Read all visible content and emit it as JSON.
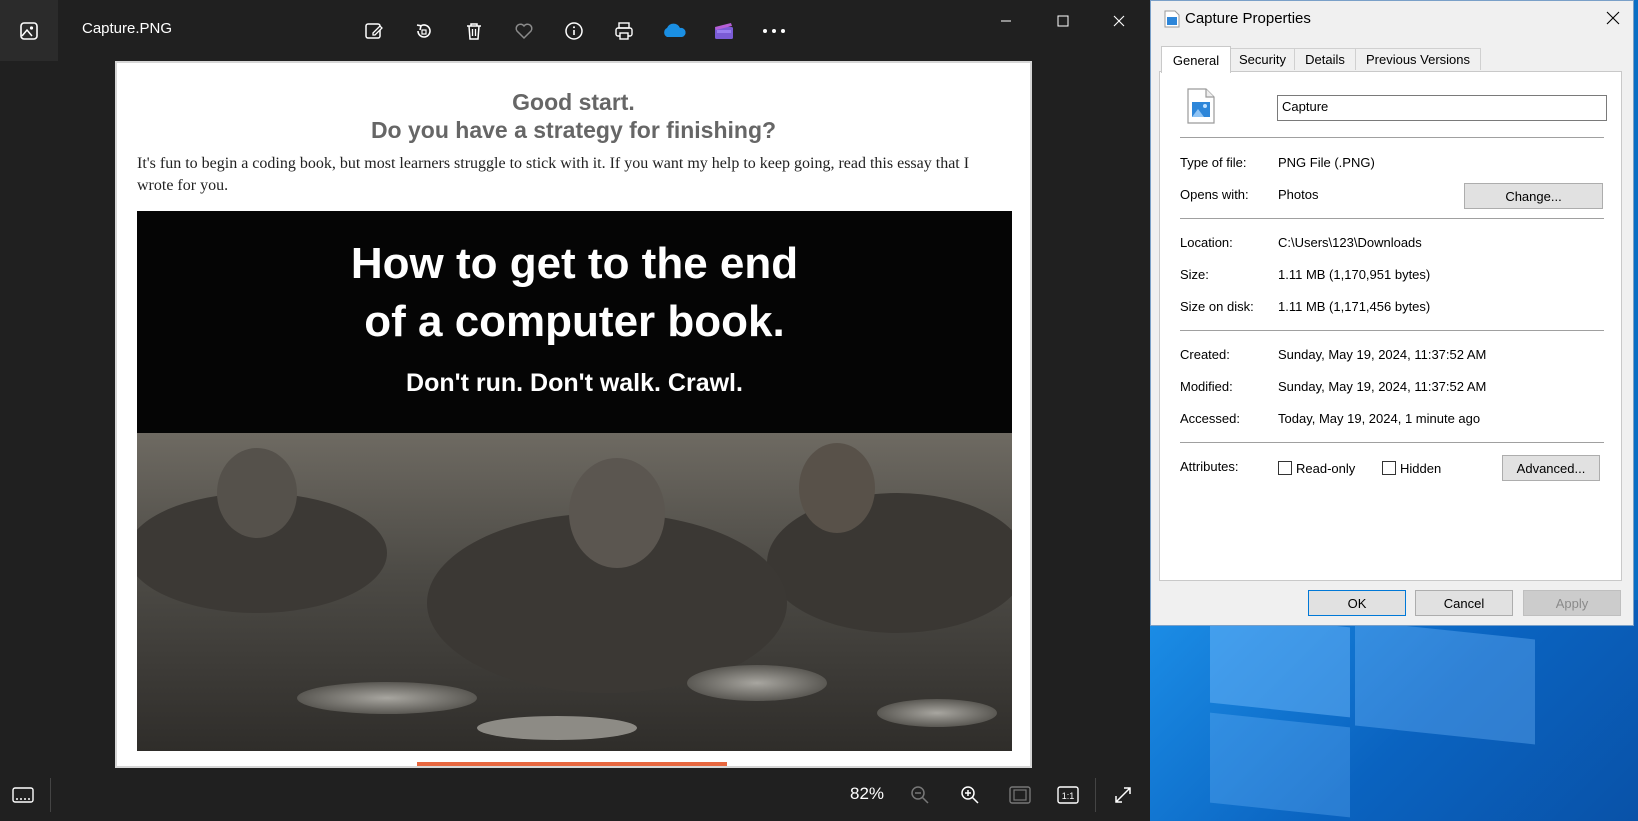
{
  "photos_app": {
    "title": "Capture.PNG",
    "toolbar": [
      "edit-image-icon",
      "rotate-icon",
      "delete-icon",
      "favorite-icon",
      "info-icon",
      "print-icon",
      "onedrive-icon",
      "video-editor-icon",
      "more-icon"
    ],
    "zoom": "82%",
    "image_content": {
      "heading1": "Good start.",
      "heading2": "Do you have a strategy for finishing?",
      "paragraph": "It's fun to begin a coding book, but most learners struggle to stick with it. If you want my help to keep going, read this essay that I wrote for you.",
      "banner_line1": "How to get to the end",
      "banner_line2": "of a computer book.",
      "banner_line3": "Don't run. Don't walk. Crawl."
    }
  },
  "dialog": {
    "title": "Capture Properties",
    "tabs": [
      {
        "label": "General",
        "active": true
      },
      {
        "label": "Security",
        "active": false
      },
      {
        "label": "Details",
        "active": false
      },
      {
        "label": "Previous Versions",
        "active": false
      }
    ],
    "file_name": "Capture",
    "type_label": "Type of file:",
    "type_value": "PNG File (.PNG)",
    "opens_label": "Opens with:",
    "opens_value": "Photos",
    "change_button": "Change...",
    "location_label": "Location:",
    "location_value": "C:\\Users\\123\\Downloads",
    "size_label": "Size:",
    "size_value": "1.11 MB (1,170,951 bytes)",
    "size_disk_label": "Size on disk:",
    "size_disk_value": "1.11 MB (1,171,456 bytes)",
    "created_label": "Created:",
    "created_value": "Sunday, May 19, 2024, 11:37:52 AM",
    "modified_label": "Modified:",
    "modified_value": "Sunday, May 19, 2024, 11:37:52 AM",
    "accessed_label": "Accessed:",
    "accessed_value": "Today, May 19, 2024, 1 minute ago",
    "attributes_label": "Attributes:",
    "readonly_label": "Read-only",
    "readonly_checked": false,
    "hidden_label": "Hidden",
    "hidden_checked": false,
    "advanced_button": "Advanced...",
    "ok_button": "OK",
    "cancel_button": "Cancel",
    "apply_button": "Apply"
  },
  "colors": {
    "app_bg": "#202020",
    "dialog_bg": "#f0f0f0",
    "accent": "#0078d7",
    "banner_orange": "#e8673f"
  }
}
